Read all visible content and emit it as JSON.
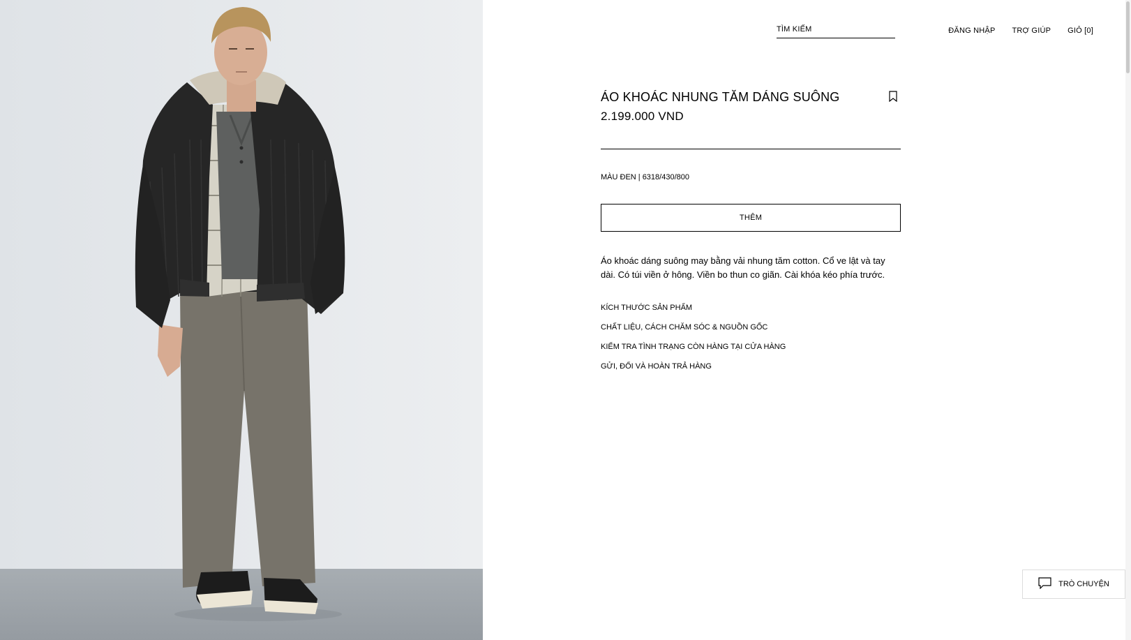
{
  "header": {
    "search_label": "TÌM KIẾM",
    "nav": {
      "login": "ĐĂNG NHẬP",
      "help": "TRỢ GIÚP",
      "cart": "GIỎ [0]"
    }
  },
  "product": {
    "title": "ÁO KHOÁC NHUNG TĂM DÁNG SUÔNG",
    "price": "2.199.000 VND",
    "color_ref": "MÀU ĐEN | 6318/430/800",
    "add_label": "THÊM",
    "description": "Áo khoác dáng suông may bằng vải nhung tăm cotton. Cổ ve lật và tay dài. Có túi viền ở hông. Viền bo thun co giãn. Cài khóa kéo phía trước."
  },
  "accordion": [
    {
      "label": "KÍCH THƯỚC SẢN PHẨM"
    },
    {
      "label": "CHẤT LIỆU, CÁCH CHĂM SÓC & NGUỒN GỐC"
    },
    {
      "label": "KIỂM TRA TÌNH TRẠNG CÒN HÀNG TẠI CỬA HÀNG"
    },
    {
      "label": "GỬI, ĐỔI VÀ HOÀN TRẢ HÀNG"
    }
  ],
  "chat": {
    "label": "TRÒ CHUYỆN"
  },
  "icons": {
    "bookmark": "bookmark-icon",
    "chat": "chat-bubble-icon"
  },
  "colors": {
    "background": "#ffffff",
    "text": "#000000",
    "photo_wall": "#e6e9ec",
    "photo_floor": "#9fa5ab"
  }
}
